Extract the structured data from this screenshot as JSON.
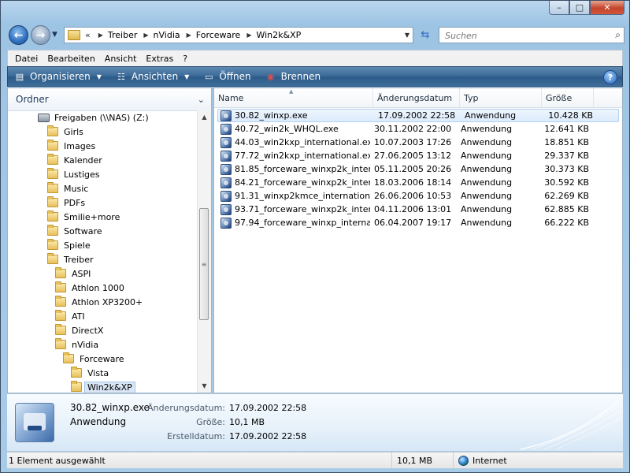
{
  "window": {
    "caption_buttons": {
      "minimize": "–",
      "maximize": "□",
      "close": "✕"
    }
  },
  "address": {
    "overflow": "«",
    "crumbs": [
      "Treiber",
      "nVidia",
      "Forceware",
      "Win2k&XP"
    ],
    "search_placeholder": "Suchen"
  },
  "menu": [
    "Datei",
    "Bearbeiten",
    "Ansicht",
    "Extras",
    "?"
  ],
  "toolbar": {
    "organize": "Organisieren",
    "views": "Ansichten",
    "open": "Öffnen",
    "burn": "Brennen",
    "help": "?"
  },
  "navpane": {
    "title": "Ordner",
    "tree": [
      {
        "label": "Freigaben (\\\\NAS) (Z:)",
        "type": "drive",
        "indent": 1
      },
      {
        "label": "Girls",
        "indent": 2
      },
      {
        "label": "Images",
        "indent": 2
      },
      {
        "label": "Kalender",
        "indent": 2
      },
      {
        "label": "Lustiges",
        "indent": 2
      },
      {
        "label": "Music",
        "indent": 2
      },
      {
        "label": "PDFs",
        "indent": 2
      },
      {
        "label": "Smilie+more",
        "indent": 2
      },
      {
        "label": "Software",
        "indent": 2
      },
      {
        "label": "Spiele",
        "indent": 2
      },
      {
        "label": "Treiber",
        "indent": 2
      },
      {
        "label": "ASPI",
        "indent": 3
      },
      {
        "label": "Athlon 1000",
        "indent": 3
      },
      {
        "label": "Athlon XP3200+",
        "indent": 3
      },
      {
        "label": "ATI",
        "indent": 3
      },
      {
        "label": "DirectX",
        "indent": 3
      },
      {
        "label": "nVidia",
        "indent": 3
      },
      {
        "label": "Forceware",
        "indent": 4
      },
      {
        "label": "Vista",
        "indent": 5
      },
      {
        "label": "Win2k&XP",
        "indent": 5,
        "selected": true
      }
    ]
  },
  "filelist": {
    "columns": [
      "Name",
      "Änderungsdatum",
      "Typ",
      "Größe"
    ],
    "rows": [
      {
        "name": "30.82_winxp.exe",
        "date": "17.09.2002 22:58",
        "type": "Anwendung",
        "size": "10.428 KB",
        "selected": true
      },
      {
        "name": "40.72_win2k_WHQL.exe",
        "date": "30.11.2002 22:00",
        "type": "Anwendung",
        "size": "12.641 KB"
      },
      {
        "name": "44.03_win2kxp_international.exe",
        "date": "10.07.2003 17:26",
        "type": "Anwendung",
        "size": "18.851 KB"
      },
      {
        "name": "77.72_win2kxp_international.exe",
        "date": "27.06.2005 13:12",
        "type": "Anwendung",
        "size": "29.337 KB"
      },
      {
        "name": "81.85_forceware_winxp2k_inter...",
        "date": "05.11.2005 20:26",
        "type": "Anwendung",
        "size": "30.373 KB"
      },
      {
        "name": "84.21_forceware_winxp2k_inter...",
        "date": "18.03.2006 18:14",
        "type": "Anwendung",
        "size": "30.592 KB"
      },
      {
        "name": "91.31_winxp2kmce_international...",
        "date": "26.06.2006 10:53",
        "type": "Anwendung",
        "size": "62.269 KB"
      },
      {
        "name": "93.71_forceware_winxp2k_inter...",
        "date": "04.11.2006 13:01",
        "type": "Anwendung",
        "size": "62.885 KB"
      },
      {
        "name": "97.94_forceware_winxp_interna...",
        "date": "06.04.2007 19:17",
        "type": "Anwendung",
        "size": "66.222 KB"
      }
    ]
  },
  "details": {
    "name": "30.82_winxp.exe",
    "type": "Anwendung",
    "modified_label": "Änderungsdatum:",
    "modified": "17.09.2002 22:58",
    "size_label": "Größe:",
    "size": "10,1 MB",
    "created_label": "Erstelldatum:",
    "created": "17.09.2002 22:58"
  },
  "statusbar": {
    "selection": "1 Element ausgewählt",
    "size": "10,1 MB",
    "zone": "Internet"
  }
}
